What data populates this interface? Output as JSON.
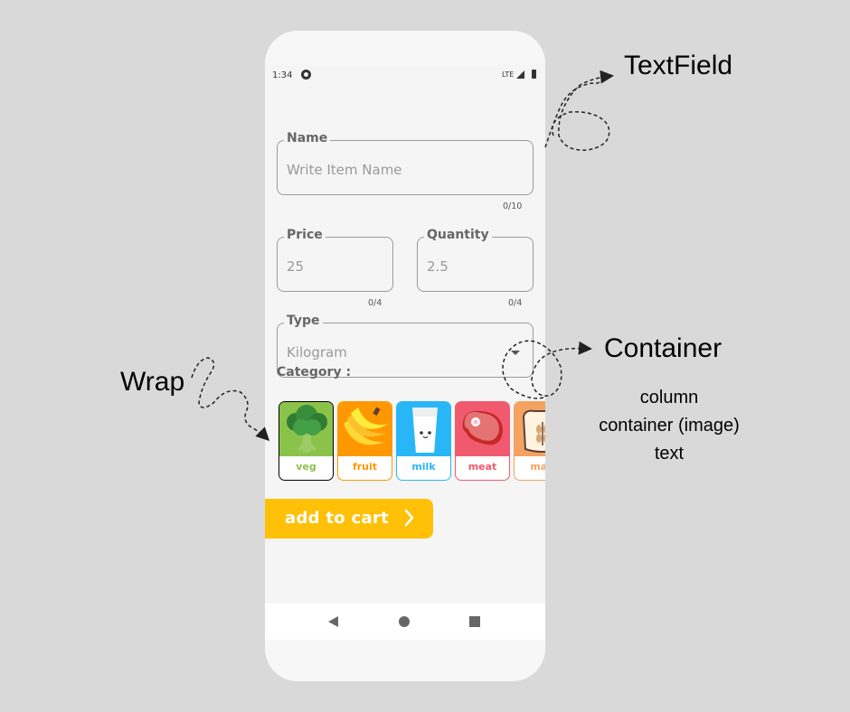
{
  "status": {
    "time": "1:34",
    "network": "LTE"
  },
  "form": {
    "name": {
      "label": "Name",
      "placeholder": "Write Item Name",
      "counter": "0/10"
    },
    "price": {
      "label": "Price",
      "value": "25",
      "counter": "0/4"
    },
    "quantity": {
      "label": "Quantity",
      "value": "2.5",
      "counter": "0/4"
    },
    "type": {
      "label": "Type",
      "value": "Kilogram"
    },
    "category_label": "Category :"
  },
  "categories": [
    {
      "label": "veg",
      "icon": "broccoli-icon",
      "color": "#8bc34a"
    },
    {
      "label": "fruit",
      "icon": "banana-icon",
      "color": "#ff9800"
    },
    {
      "label": "milk",
      "icon": "milk-icon",
      "color": "#29b6f6"
    },
    {
      "label": "meat",
      "icon": "meat-icon",
      "color": "#f15a6e"
    },
    {
      "label": "mar",
      "icon": "wheat-bag-icon",
      "color": "#f4a261"
    }
  ],
  "add_button": {
    "label": "add to cart",
    "color": "#ffc107"
  },
  "annotations": {
    "textfield": "TextField",
    "wrap": "Wrap",
    "container": "Container",
    "container_parts": [
      "column",
      "container (image)",
      "text"
    ]
  }
}
